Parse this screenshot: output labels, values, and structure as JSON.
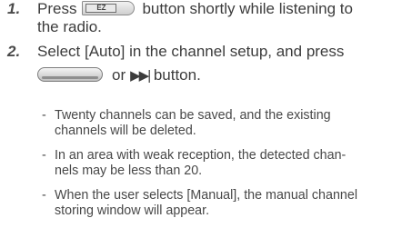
{
  "steps": [
    {
      "number": "1.",
      "text_before": "Press",
      "button_label": "EZ",
      "text_after": "button shortly while listening to",
      "line2": "the radio."
    },
    {
      "number": "2.",
      "line1": "Select [Auto] in the channel setup, and press",
      "text_or": "or",
      "skip_icon": "▶▶|",
      "text_after": "button."
    }
  ],
  "notes": [
    {
      "dash": "-",
      "line1": "Twenty channels can be saved, and the existing",
      "line2": "channels will be deleted."
    },
    {
      "dash": "-",
      "line1": "In an area with weak reception, the detected chan-",
      "line2": "nels may be less than 20."
    },
    {
      "dash": "-",
      "line1": "When the user selects [Manual], the manual channel",
      "line2": "storing window will appear."
    }
  ]
}
